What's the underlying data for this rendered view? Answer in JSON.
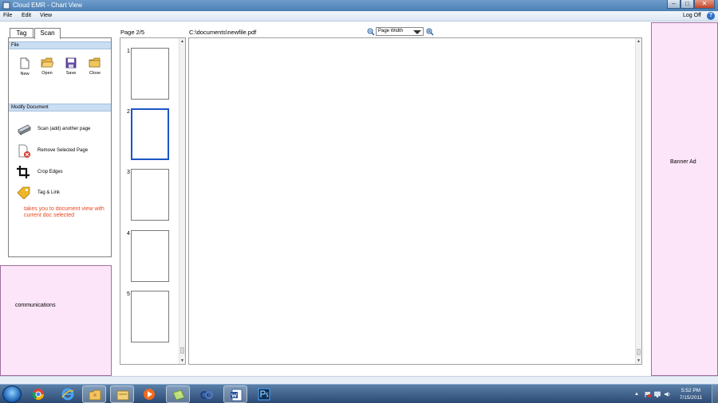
{
  "window": {
    "title": "Cloud EMR - Chart View"
  },
  "menu": {
    "items": [
      "File",
      "Edit",
      "View"
    ],
    "log_off": "Log Off",
    "help": "?"
  },
  "left_panel": {
    "tabs": [
      {
        "label": "Tag",
        "active": false
      },
      {
        "label": "Scan",
        "active": true
      }
    ],
    "file_section": {
      "header": "File",
      "buttons": [
        {
          "label": "New",
          "icon": "new-document-icon"
        },
        {
          "label": "Open",
          "icon": "open-folder-icon"
        },
        {
          "label": "Save",
          "icon": "save-disk-icon"
        },
        {
          "label": "Close",
          "icon": "close-folder-icon"
        }
      ]
    },
    "modify_section": {
      "header": "Modify Document",
      "actions": [
        {
          "label": "Scan (add) another page",
          "icon": "scanner-icon"
        },
        {
          "label": "Remove Selected Page",
          "icon": "remove-page-icon"
        },
        {
          "label": "Crop Edges",
          "icon": "crop-icon"
        },
        {
          "label": "Tag & Link",
          "icon": "tag-icon"
        }
      ],
      "note": "takes you to document view with current doc selected"
    }
  },
  "communications": {
    "label": "communications"
  },
  "thumbnails": {
    "page_indicator": "Page 2/5",
    "pages": [
      {
        "number": "1",
        "selected": false
      },
      {
        "number": "2",
        "selected": true
      },
      {
        "number": "3",
        "selected": false
      },
      {
        "number": "4",
        "selected": false
      },
      {
        "number": "5",
        "selected": false
      }
    ]
  },
  "document": {
    "file_path": "C:\\documents\\newfile.pdf",
    "zoom_value": "Page Width"
  },
  "banner": {
    "label": "Banner Ad"
  },
  "taskbar": {
    "apps": [
      "chrome-icon",
      "internet-explorer-icon",
      "folder-people-icon",
      "file-explorer-icon",
      "media-player-icon",
      "image-viewer-icon",
      "network-icon",
      "word-icon",
      "photoshop-icon"
    ],
    "clock": {
      "time": "5:52 PM",
      "date": "7/15/2011"
    }
  },
  "colors": {
    "accent": "#1a56c4",
    "pink_panel": "#fde5f9",
    "section_header": "#c9ddf3",
    "note": "#e8471f"
  }
}
